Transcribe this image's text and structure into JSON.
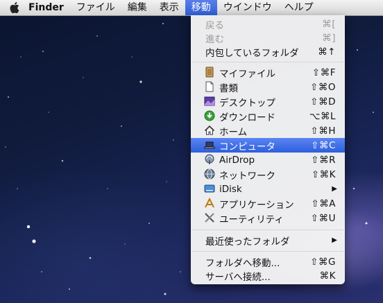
{
  "menubar": {
    "apple_icon": "apple-logo-icon",
    "app_name": "Finder",
    "menus": [
      "ファイル",
      "編集",
      "表示",
      "移動",
      "ウインドウ",
      "ヘルプ"
    ],
    "active_menu": "移動"
  },
  "go_menu": {
    "back": {
      "label": "戻る",
      "shortcut": "⌘["
    },
    "forward": {
      "label": "進む",
      "shortcut": "⌘]"
    },
    "enclosing": {
      "label": "内包しているフォルダ",
      "shortcut": "⌘↑"
    },
    "myfiles": {
      "label": "マイファイル",
      "shortcut": "⇧⌘F",
      "icon": "all-my-files-icon"
    },
    "documents": {
      "label": "書類",
      "shortcut": "⇧⌘O",
      "icon": "document-icon"
    },
    "desktop": {
      "label": "デスクトップ",
      "shortcut": "⇧⌘D",
      "icon": "desktop-icon"
    },
    "downloads": {
      "label": "ダウンロード",
      "shortcut": "⌥⌘L",
      "icon": "download-icon"
    },
    "home": {
      "label": "ホーム",
      "shortcut": "⇧⌘H",
      "icon": "home-icon"
    },
    "computer": {
      "label": "コンピュータ",
      "shortcut": "⇧⌘C",
      "icon": "laptop-icon"
    },
    "airdrop": {
      "label": "AirDrop",
      "shortcut": "⇧⌘R",
      "icon": "airdrop-icon"
    },
    "network": {
      "label": "ネットワーク",
      "shortcut": "⇧⌘K",
      "icon": "globe-icon"
    },
    "idisk": {
      "label": "iDisk",
      "submenu": "▶",
      "icon": "idisk-icon"
    },
    "applications": {
      "label": "アプリケーション",
      "shortcut": "⇧⌘A",
      "icon": "applications-icon"
    },
    "utilities": {
      "label": "ユーティリティ",
      "shortcut": "⇧⌘U",
      "icon": "utilities-icon"
    },
    "recent": {
      "label": "最近使ったフォルダ",
      "submenu": "▶"
    },
    "goto": {
      "label": "フォルダへ移動...",
      "shortcut": "⇧⌘G"
    },
    "connect": {
      "label": "サーバへ接続...",
      "shortcut": "⌘K"
    }
  },
  "colors": {
    "selection": "#3a68e0",
    "menubar": "#e6e6e6"
  }
}
